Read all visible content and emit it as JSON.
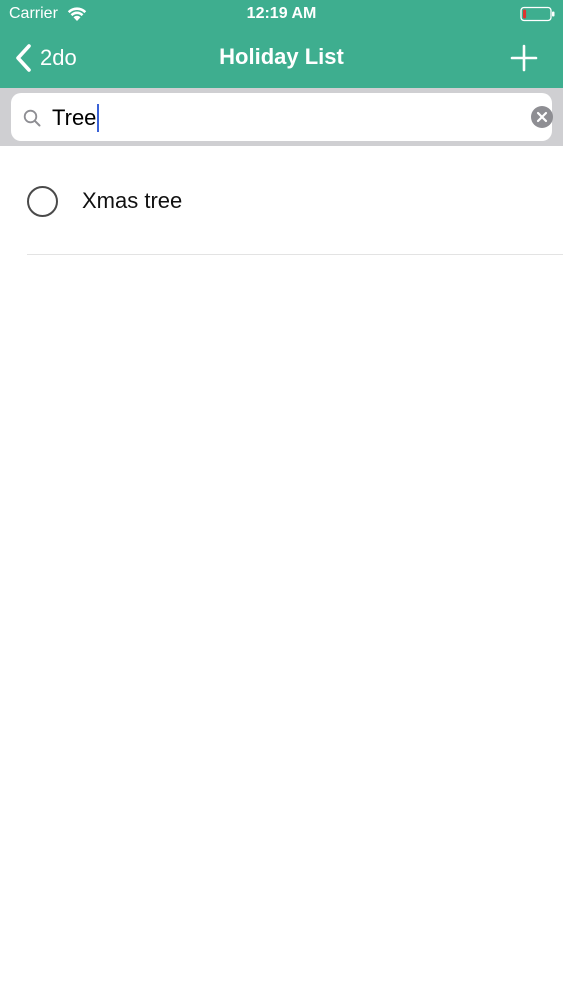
{
  "status_bar": {
    "carrier": "Carrier",
    "time": "12:19 AM",
    "battery_level": 0.12,
    "battery_color": "#e0332f"
  },
  "nav_bar": {
    "back_label": "2do",
    "title": "Holiday List",
    "add_icon": "plus-icon",
    "color": "#3eae8f"
  },
  "search": {
    "value": "Tree",
    "search_icon": "magnifier-icon",
    "clear_icon": "clear-circle-icon"
  },
  "list": {
    "items": [
      {
        "label": "Xmas tree",
        "checked": false
      }
    ]
  }
}
